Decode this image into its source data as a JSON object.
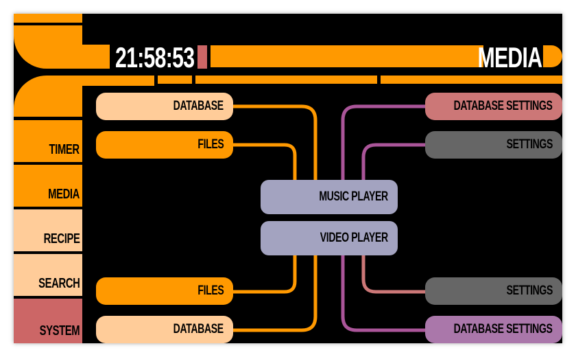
{
  "header": {
    "clock": "21:58:53",
    "title": "MEDIA"
  },
  "sidebar": {
    "items": [
      {
        "label": "TIMER",
        "color": "#ff9900"
      },
      {
        "label": "MEDIA",
        "color": "#ff9900"
      },
      {
        "label": "RECIPE",
        "color": "#ffcc99"
      },
      {
        "label": "SEARCH",
        "color": "#ffcc99"
      },
      {
        "label": "SYSTEM",
        "color": "#cc6666"
      }
    ]
  },
  "left_nodes": {
    "top_database": "DATABASE",
    "top_files": "FILES",
    "bottom_files": "FILES",
    "bottom_database": "DATABASE"
  },
  "center_nodes": {
    "music_player": "MUSIC PLAYER",
    "video_player": "VIDEO PLAYER"
  },
  "right_nodes": {
    "top_database_settings": "DATABASE SETTINGS",
    "top_settings": "SETTINGS",
    "bottom_settings": "SETTINGS",
    "bottom_database_settings": "DATABASE SETTINGS"
  },
  "colors": {
    "orange": "#ff9900",
    "peach": "#ffcc99",
    "rose": "#cc7777",
    "red": "#cc6666",
    "grey": "#666666",
    "lilac": "#a3a3c0",
    "violet": "#aa77aa",
    "black": "#000000"
  }
}
